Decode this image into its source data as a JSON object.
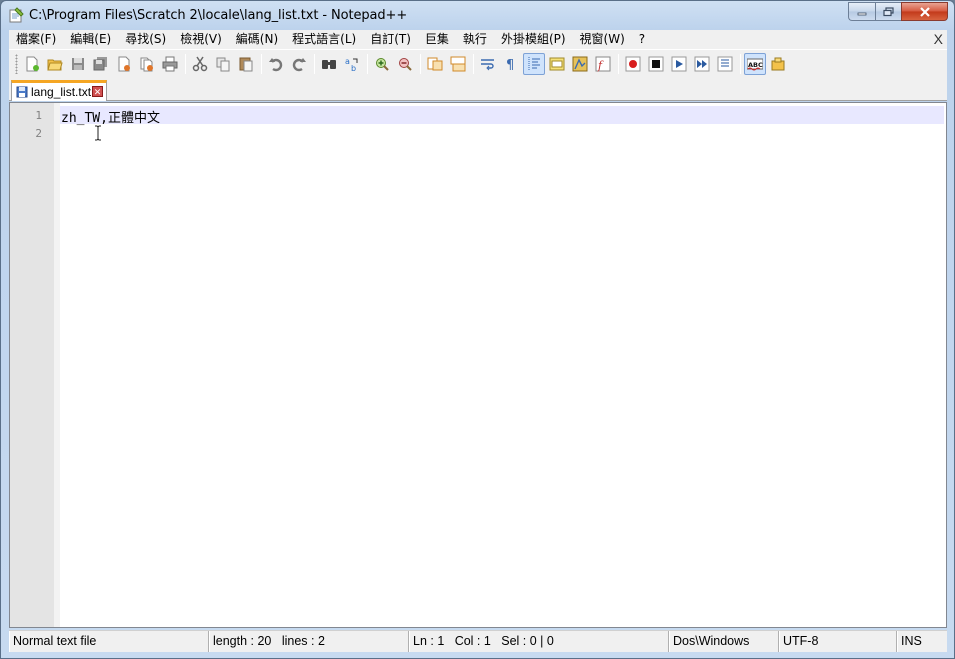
{
  "window": {
    "title": "C:\\Program Files\\Scratch 2\\locale\\lang_list.txt - Notepad++"
  },
  "menu": {
    "items": [
      "檔案(F)",
      "編輯(E)",
      "尋找(S)",
      "檢視(V)",
      "編碼(N)",
      "程式語言(L)",
      "自訂(T)",
      "巨集",
      "執行",
      "外掛模組(P)",
      "視窗(W)",
      "?"
    ],
    "close_glyph": "X"
  },
  "toolbar": {
    "icons": [
      "new-file-icon",
      "open-file-icon",
      "save-icon",
      "save-all-icon",
      "close-icon",
      "close-all-icon",
      "print-icon",
      "cut-icon",
      "copy-icon",
      "paste-icon",
      "undo-icon",
      "redo-icon",
      "find-icon",
      "replace-icon",
      "zoom-in-icon",
      "zoom-out-icon",
      "sync-vertical-icon",
      "sync-horizontal-icon",
      "word-wrap-icon",
      "show-all-chars-icon",
      "indent-guide-icon",
      "user-lang-icon",
      "doc-map-icon",
      "function-list-icon",
      "record-macro-icon",
      "stop-macro-icon",
      "play-macro-icon",
      "run-macro-multiple-icon",
      "save-macro-icon",
      "spell-check-icon",
      "plugin-icon"
    ]
  },
  "tab": {
    "label": "lang_list.txt",
    "close_glyph": "✕"
  },
  "editor": {
    "line_numbers": [
      "1",
      "2"
    ],
    "lines": [
      "zh_TW,正體中文",
      ""
    ]
  },
  "status": {
    "file_type": "Normal text file",
    "length": "length : 20",
    "lines": "lines : 2",
    "ln": "Ln : 1",
    "col": "Col : 1",
    "sel": "Sel : 0 | 0",
    "eol": "Dos\\Windows",
    "encoding": "UTF-8",
    "mode": "INS"
  },
  "colors": {
    "accent_tab": "#f5a623",
    "current_line": "#e8e8ff",
    "gutter": "#e4e4e4"
  }
}
